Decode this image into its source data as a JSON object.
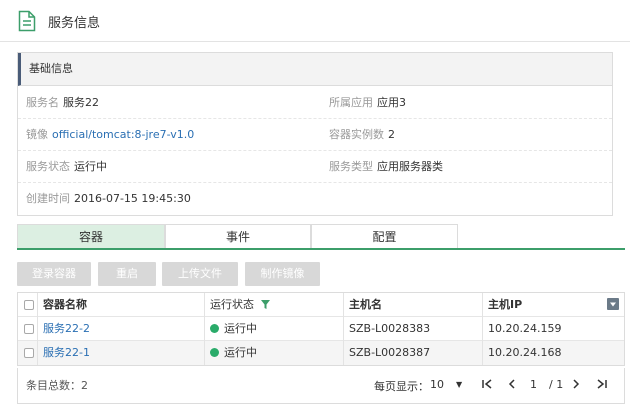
{
  "page": {
    "title": "服务信息"
  },
  "basic": {
    "heading": "基础信息",
    "service_name_label": "服务名",
    "service_name": "服务22",
    "app_label": "所属应用",
    "app": "应用3",
    "image_label": "镜像",
    "image": "official/tomcat:8-jre7-v1.0",
    "instances_label": "容器实例数",
    "instances": "2",
    "status_label": "服务状态",
    "status": "运行中",
    "type_label": "服务类型",
    "type": "应用服务器类",
    "created_label": "创建时间",
    "created": "2016-07-15 19:45:30"
  },
  "tabs": [
    "容器",
    "事件",
    "配置"
  ],
  "toolbar": {
    "login": "登录容器",
    "restart": "重启",
    "upload": "上传文件",
    "make_image": "制作镜像"
  },
  "table": {
    "columns": [
      "容器名称",
      "运行状态",
      "主机名",
      "主机IP"
    ],
    "rows": [
      {
        "name": "服务22-2",
        "status": "运行中",
        "host": "SZB-L0028383",
        "ip": "10.20.24.159"
      },
      {
        "name": "服务22-1",
        "status": "运行中",
        "host": "SZB-L0028387",
        "ip": "10.20.24.168"
      }
    ]
  },
  "footer": {
    "total_label": "条目总数：",
    "total": "2",
    "per_page_label": "每页显示：",
    "per_page": "10",
    "current_page": "1",
    "total_pages": "/ 1"
  },
  "colors": {
    "accent_green": "#3c9e6a",
    "tab_active_bg": "#dcefe2",
    "link_blue": "#2a6fb3",
    "status_green": "#2aab6a",
    "button_disabled": "#d8d8d8"
  },
  "icons": {
    "header": "document-icon",
    "filter": "filter-icon",
    "column_menu": "dropdown-icon",
    "first": "first-page-icon",
    "prev": "prev-page-icon",
    "next": "next-page-icon",
    "last": "last-page-icon"
  }
}
